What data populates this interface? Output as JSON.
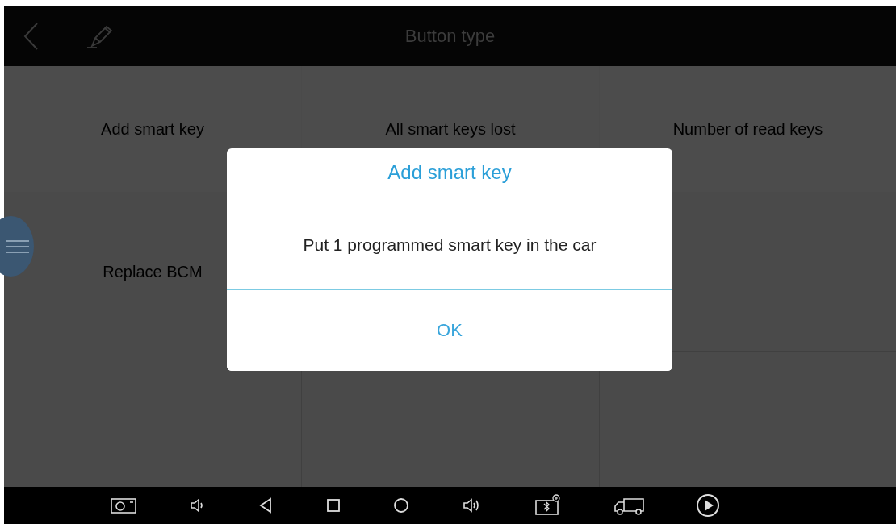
{
  "header": {
    "title": "Button type"
  },
  "grid": {
    "cells": [
      {
        "label": "Add smart key"
      },
      {
        "label": "All smart keys lost"
      },
      {
        "label": "Number of read keys"
      },
      {
        "label": "Replace BCM"
      },
      {},
      {},
      {},
      {},
      {}
    ]
  },
  "dialog": {
    "title": "Add smart key",
    "message": "Put 1 programmed smart key in the car",
    "button": "OK"
  }
}
